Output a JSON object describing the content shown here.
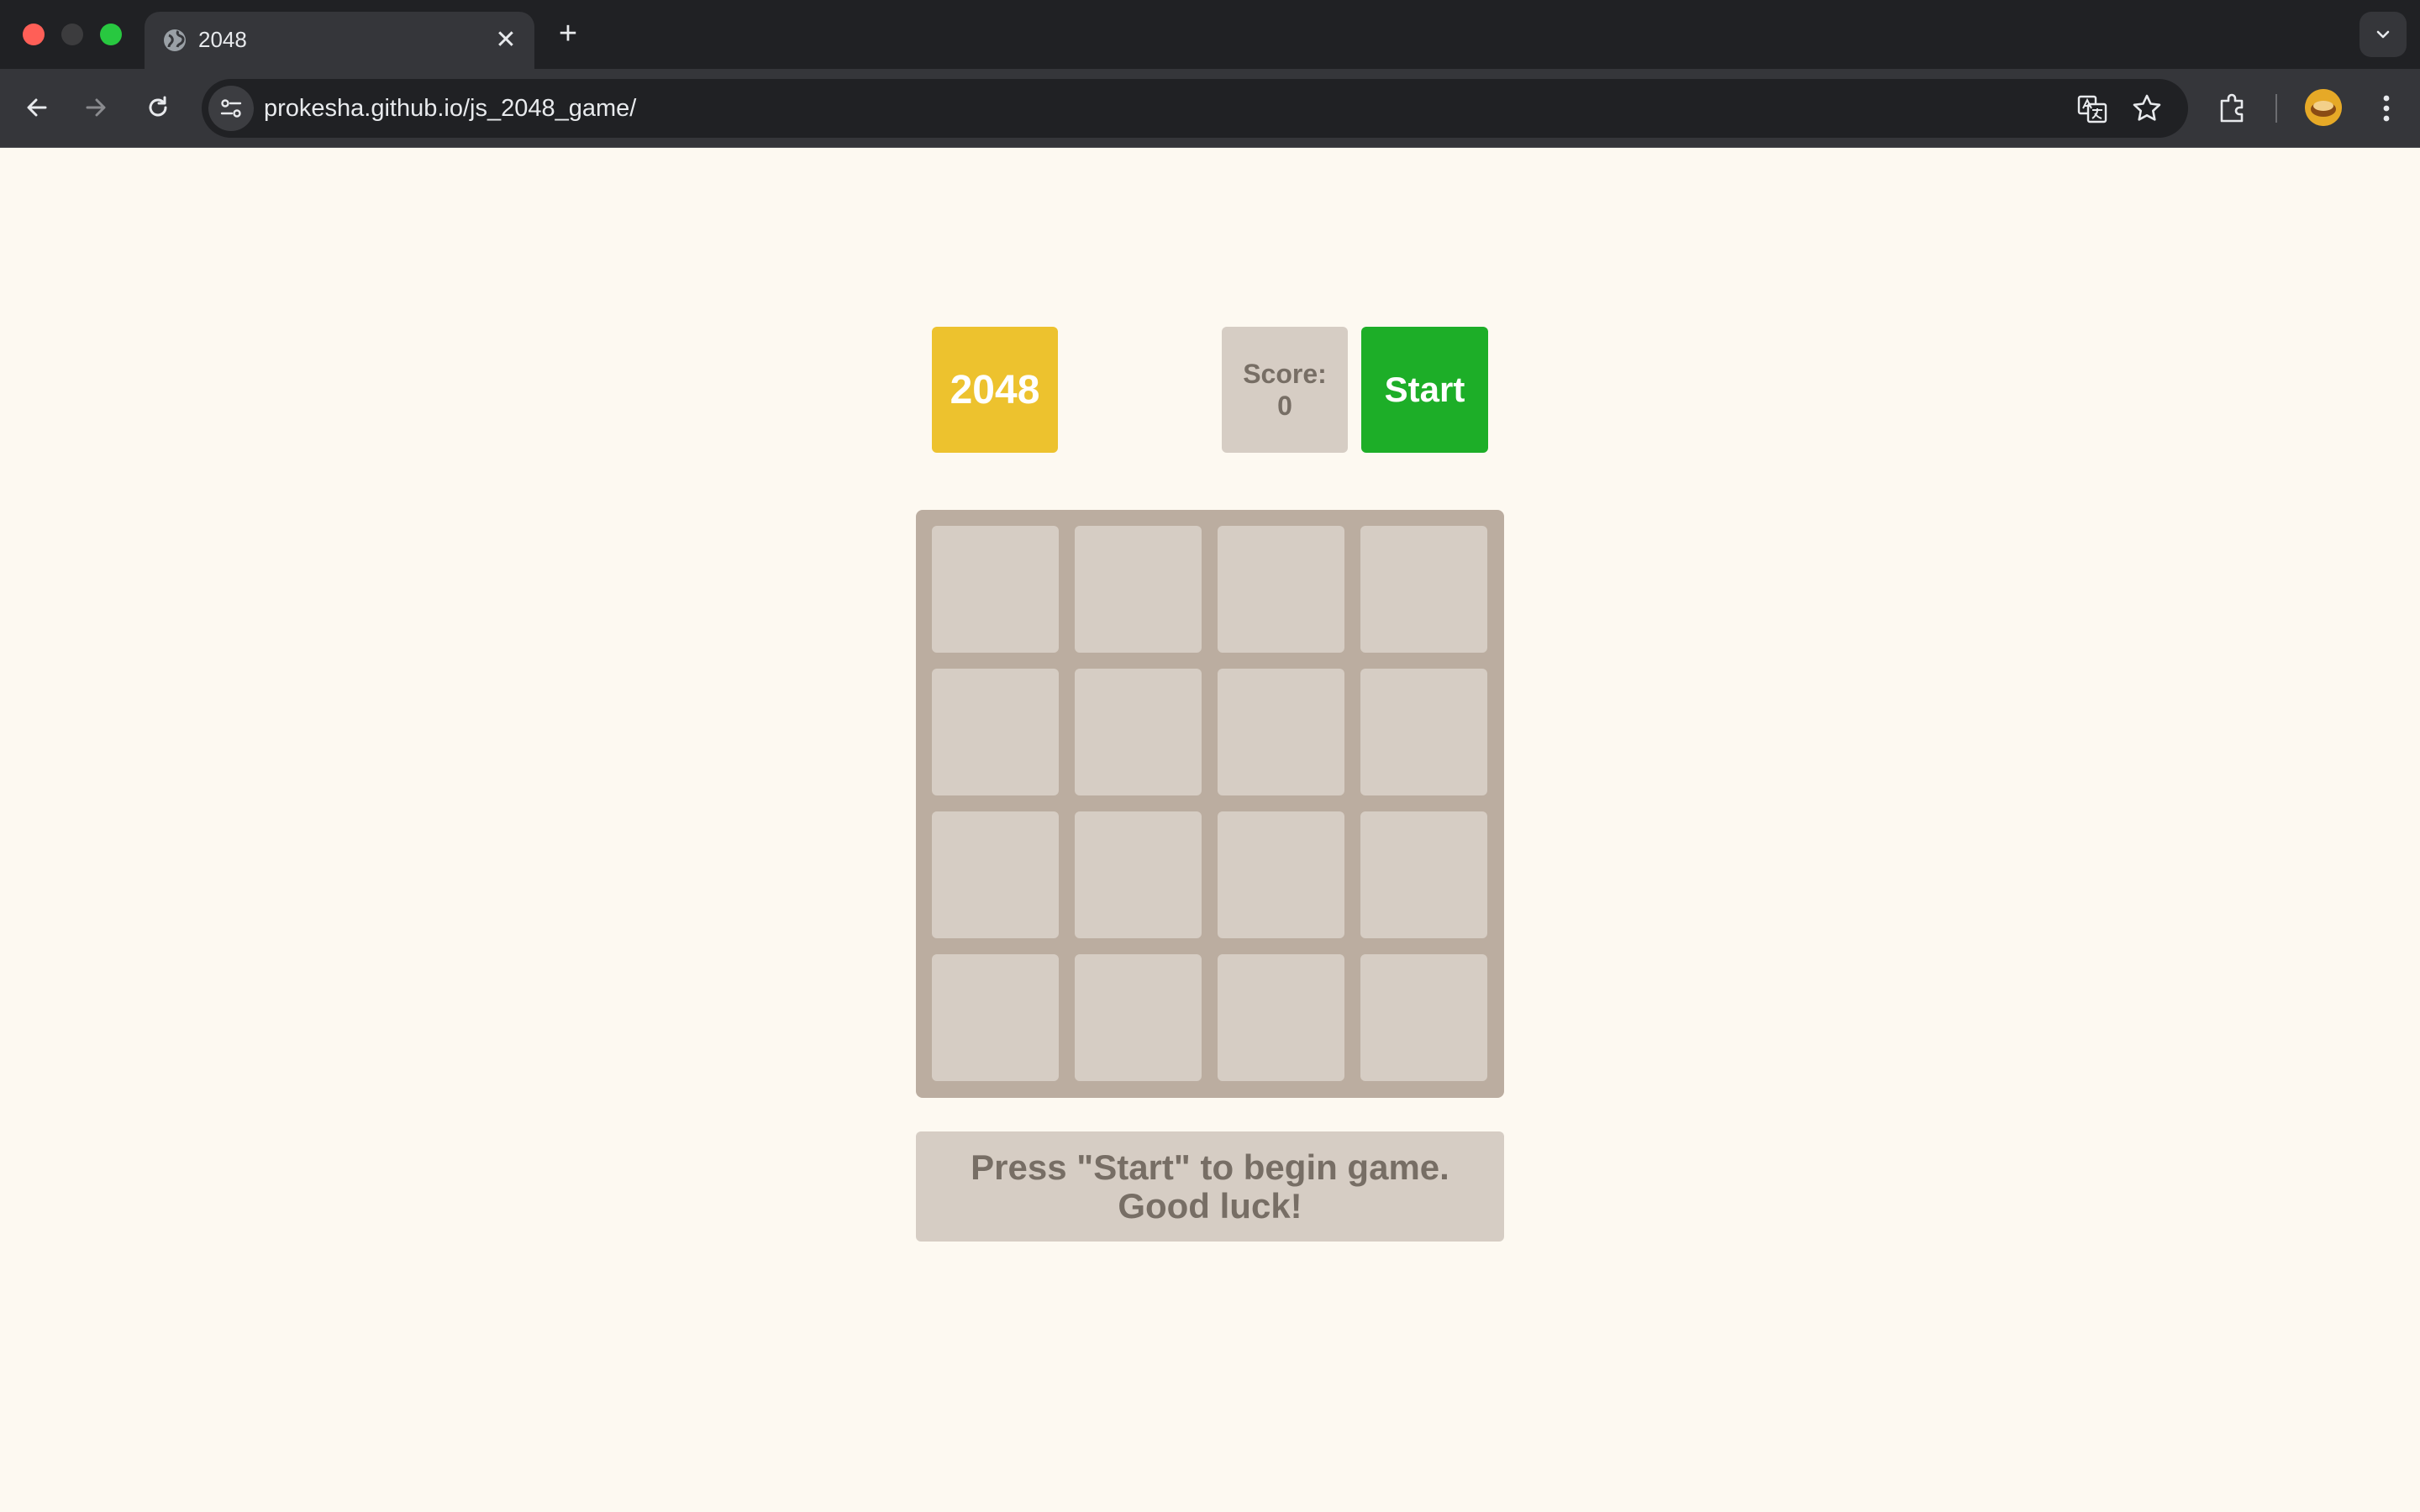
{
  "browser": {
    "tab_title": "2048",
    "tab_close_glyph": "✕",
    "new_tab_glyph": "+",
    "url": "prokesha.github.io/js_2048_game/",
    "icons": [
      "globe-icon",
      "back-arrow-icon",
      "forward-arrow-icon",
      "reload-icon",
      "site-info-icon",
      "translate-icon",
      "bookmark-star-icon",
      "extensions-icon",
      "profile-avatar",
      "more-menu-icon",
      "tab-search-icon"
    ]
  },
  "game": {
    "logo": "2048",
    "score_label": "Score:",
    "score_value": "0",
    "start_label": "Start",
    "grid_size": 4,
    "cells": [
      "",
      "",
      "",
      "",
      "",
      "",
      "",
      "",
      "",
      "",
      "",
      "",
      "",
      "",
      "",
      ""
    ],
    "message": "Press \"Start\" to begin game. Good luck!"
  },
  "colors": {
    "page_bg": "#fdf9f1",
    "logo_bg": "#edc22e",
    "start_bg": "#1dae28",
    "board_bg": "#bbada0",
    "cell_bg": "#d6cdc4",
    "text": "#776e65"
  }
}
